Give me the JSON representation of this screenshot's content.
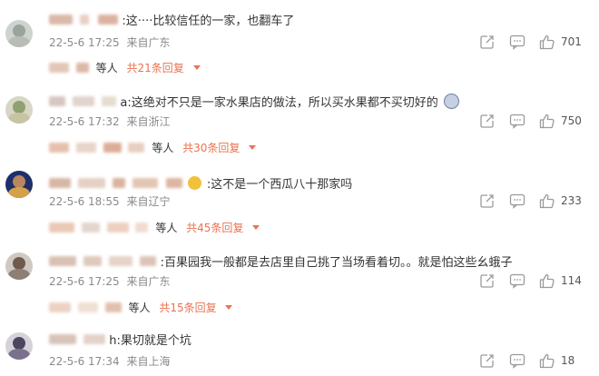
{
  "comments": [
    {
      "text": ":这····比较信任的一家，也翻车了",
      "date": "22-5-6 17:25",
      "location": "来自广东",
      "likes": "701",
      "reply_who": "等人",
      "reply_count": "共21条回复"
    },
    {
      "text": "a:这绝对不只是一家水果店的做法，所以买水果都不买切好的",
      "date": "22-5-6 17:32",
      "location": "来自浙江",
      "likes": "750",
      "reply_who": "等人",
      "reply_count": "共30条回复"
    },
    {
      "text": ":这不是一个西瓜八十那家吗",
      "date": "22-5-6 18:55",
      "location": "来自辽宁",
      "likes": "233",
      "reply_who": "等人",
      "reply_count": "共45条回复"
    },
    {
      "text": ":百果园我一般都是去店里自己挑了当场看着切。。就是怕这些幺蛾子",
      "date": "22-5-6 17:25",
      "location": "来自广东",
      "likes": "114",
      "reply_who": "等人",
      "reply_count": "共15条回复"
    },
    {
      "text": "h:果切就是个坑",
      "date": "22-5-6 17:34",
      "location": "来自上海",
      "likes": "18",
      "reply_who": "",
      "reply_count": ""
    }
  ],
  "icons": [
    "share-icon",
    "comment-icon",
    "thumbs-up-icon",
    "chevron-down-icon"
  ],
  "colors": {
    "reply_link": "#eb7350",
    "meta": "#8a8a8a",
    "text": "#333333"
  }
}
